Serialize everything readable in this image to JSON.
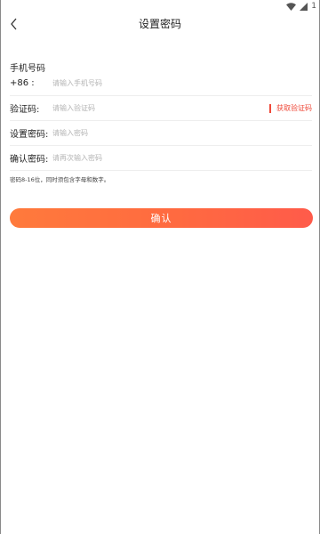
{
  "status_bar": {
    "battery_text": "1"
  },
  "header": {
    "title": "设置密码"
  },
  "form": {
    "phone": {
      "section_label": "手机号码",
      "country_code": "+86 :",
      "placeholder": "请输入手机号码"
    },
    "code": {
      "label": "验证码:",
      "placeholder": "请输入验证码",
      "button_label": "获取验证码"
    },
    "password": {
      "label": "设置密码:",
      "placeholder": "请输入密码"
    },
    "confirm_password": {
      "label": "确认密码:",
      "placeholder": "请再次输入密码"
    },
    "hint": "密码8-16位，同时须包含字母和数字。",
    "submit_label": "确认"
  },
  "colors": {
    "accent": "#ef4a3a",
    "button_gradient_start": "#ff7a3c",
    "button_gradient_end": "#ff5b4a"
  },
  "icons": {
    "back": "chevron-left-icon",
    "wifi": "wifi-icon",
    "signal": "signal-icon"
  }
}
